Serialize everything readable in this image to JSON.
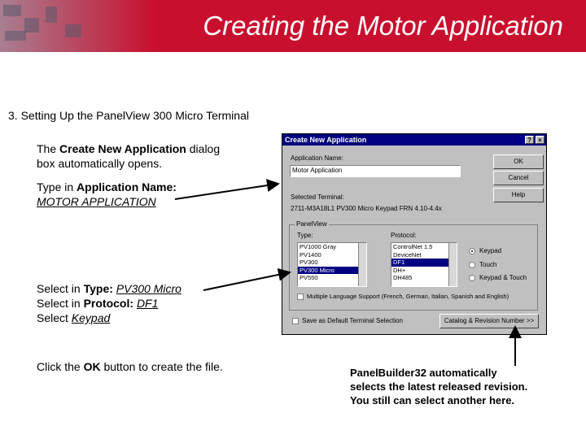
{
  "header": {
    "title": "Creating the Motor Application"
  },
  "subtitle": "3.  Setting Up the PanelView 300 Micro Terminal",
  "instructions": {
    "p1_a": "The ",
    "p1_b": "Create New Application",
    "p1_c": " dialog",
    "p1_d": " box automatically opens.",
    "p2_a": "Type in ",
    "p2_b": "Application Name:",
    "p2_c": "MOTOR APPLICATION",
    "p3_a": "Select in ",
    "p3_b": "Type: ",
    "p3_c": "PV300 Micro",
    "p4_a": "Select in ",
    "p4_b": "Protocol: ",
    "p4_c": "DF1",
    "p5_a": "Select ",
    "p5_b": "Keypad",
    "p6_a": "Click the ",
    "p6_b": "OK",
    "p6_c": " button to create the file."
  },
  "note": {
    "line1": "PanelBuilder32 automatically",
    "line2": "selects the latest released revision.",
    "line3": "You still can select another here."
  },
  "dialog": {
    "title": "Create New Application",
    "help_glyph": "?",
    "close_glyph": "×",
    "app_name_label": "Application Name:",
    "app_name_value": "Motor Application",
    "ok": "OK",
    "cancel": "Cancel",
    "help": "Help",
    "selected_terminal_label": "Selected Terminal:",
    "selected_terminal_value": "2711-M3A18L1 PV300 Micro Keypad FRN 4.10-4.4x",
    "panelview_group": "PanelView",
    "type_label": "Type:",
    "types": [
      "PV1000 Gray",
      "PV1400",
      "PV300",
      "PV300 Micro",
      "PV550"
    ],
    "type_selected": "PV300 Micro",
    "protocol_label": "Protocol:",
    "protocols": [
      "ControlNet 1.5",
      "DeviceNet",
      "DF1",
      "DH+",
      "DH485"
    ],
    "protocol_selected": "DF1",
    "radio_keypad": "Keypad",
    "radio_touch": "Touch",
    "radio_keypad_touch": "Keypad & Touch",
    "multi_lang": "Multiple Language Support (French, German, Italian, Spanish and English)",
    "save_default": "Save as Default Terminal Selection",
    "catalog_btn": "Catalog & Revision Number >>"
  }
}
